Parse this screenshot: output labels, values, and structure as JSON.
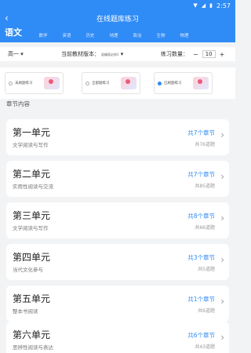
{
  "status": {
    "time": "2:57",
    "wifi_icon": "wifi-icon",
    "signal_icon": "signal-icon",
    "battery_icon": "battery-icon"
  },
  "header": {
    "title": "在线题库练习",
    "back_icon": "back-arrow-icon"
  },
  "subjects": {
    "active": "语文",
    "items": [
      "数学",
      "英语",
      "历史",
      "地理",
      "政治",
      "生物",
      "物理"
    ]
  },
  "filters": {
    "grade": "高一",
    "edition_label": "当前教材版本：",
    "edition_value": "部编版必修1",
    "quantity_label": "练习数量：",
    "quantity_value": "10",
    "minus": "−",
    "plus": "+"
  },
  "modes": [
    {
      "label": "未刷题练习",
      "selected": false
    },
    {
      "label": "全部题练习",
      "selected": false
    },
    {
      "label": "已刷题练习",
      "selected": true
    }
  ],
  "section_title": "章节内容",
  "units": [
    {
      "name": "第一单元",
      "sub": "文学阅读与写作",
      "chapters": "共7个章节",
      "count": "共76道题"
    },
    {
      "name": "第二单元",
      "sub": "实用性阅读与交流",
      "chapters": "共7个章节",
      "count": "共85道题"
    },
    {
      "name": "第三单元",
      "sub": "文学阅读与写作",
      "chapters": "共8个章节",
      "count": "共66道题"
    },
    {
      "name": "第四单元",
      "sub": "当代文化参与",
      "chapters": "共3个章节",
      "count": "共5道题"
    },
    {
      "name": "第五单元",
      "sub": "整本书阅读",
      "chapters": "共1个章节",
      "count": "共6道题"
    },
    {
      "name": "第六单元",
      "sub": "思辨性阅读与表达",
      "chapters": "共6个章节",
      "count": "共43道题"
    }
  ],
  "colors": {
    "accent": "#2f8bf5",
    "background": "#f2f3f5"
  }
}
